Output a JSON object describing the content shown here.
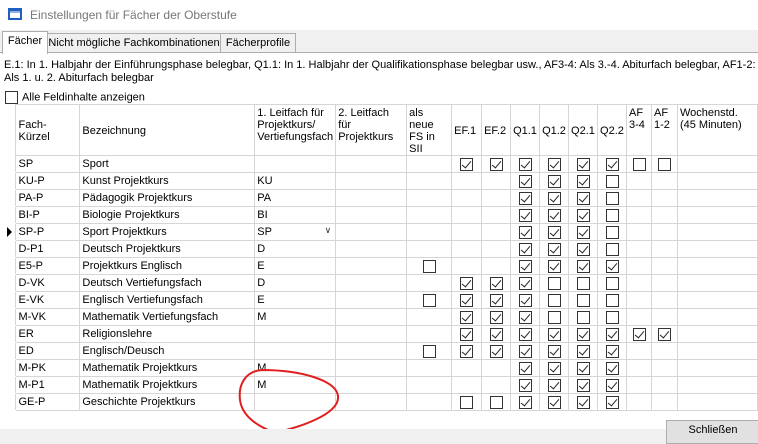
{
  "window": {
    "title": "Einstellungen für Fächer der Oberstufe"
  },
  "tabs": [
    {
      "label": "Fächer",
      "active": true
    },
    {
      "label": "Nicht mögliche Fachkombinationen",
      "active": false
    },
    {
      "label": "Fächerprofile",
      "active": false
    }
  ],
  "hint": {
    "line1": "E.1: In 1. Halbjahr der Einführungsphase belegbar, Q1.1: In 1. Halbjahr der Qualifikationsphase belegbar usw., AF3-4: Als 3.-4. Abiturfach belegbar, AF1-2:",
    "line2": "Als 1. u. 2. Abiturfach belegbar"
  },
  "show_all": {
    "label": "Alle Feldinhalte anzeigen",
    "checked": false
  },
  "columns": [
    "Fach-Kürzel",
    "Bezeichnung",
    "1. Leitfach für Projektkurs/ Vertiefungsfach",
    "2. Leitfach für Projektkurs",
    "als neue FS in SII",
    "EF.1",
    "EF.2",
    "Q1.1",
    "Q1.2",
    "Q2.1",
    "Q2.2",
    "AF 3-4",
    "AF 1-2",
    "Wochenstd. (45 Minuten)"
  ],
  "rows": [
    {
      "kuerzel": "SP",
      "bezeichnung": "Sport",
      "leit1": "",
      "leit2": "",
      "fs": null,
      "checks": [
        true,
        true,
        true,
        true,
        true,
        true,
        false,
        false
      ]
    },
    {
      "kuerzel": "KU-P",
      "bezeichnung": "Kunst Projektkurs",
      "leit1": "KU",
      "leit2": "",
      "fs": null,
      "checks": [
        null,
        null,
        true,
        true,
        true,
        false,
        null,
        null
      ]
    },
    {
      "kuerzel": "PA-P",
      "bezeichnung": "Pädagogik Projektkurs",
      "leit1": "PA",
      "leit2": "",
      "fs": null,
      "checks": [
        null,
        null,
        true,
        true,
        true,
        false,
        null,
        null
      ]
    },
    {
      "kuerzel": "BI-P",
      "bezeichnung": "Biologie Projektkurs",
      "leit1": "BI",
      "leit2": "",
      "fs": null,
      "checks": [
        null,
        null,
        true,
        true,
        true,
        false,
        null,
        null
      ]
    },
    {
      "kuerzel": "SP-P",
      "bezeichnung": "Sport Projektkurs",
      "leit1": "SP",
      "leit2": "",
      "fs": null,
      "checks": [
        null,
        null,
        true,
        true,
        true,
        false,
        null,
        null
      ],
      "selected": true
    },
    {
      "kuerzel": "D-P1",
      "bezeichnung": "Deutsch Projektkurs",
      "leit1": "D",
      "leit2": "",
      "fs": null,
      "checks": [
        null,
        null,
        true,
        true,
        true,
        false,
        null,
        null
      ]
    },
    {
      "kuerzel": "E5-P",
      "bezeichnung": "Projektkurs Englisch",
      "leit1": "E",
      "leit2": "",
      "fs": false,
      "checks": [
        null,
        null,
        true,
        true,
        true,
        true,
        null,
        null
      ]
    },
    {
      "kuerzel": "D-VK",
      "bezeichnung": "Deutsch Vertiefungsfach",
      "leit1": "D",
      "leit2": "",
      "fs": null,
      "checks": [
        true,
        true,
        true,
        false,
        false,
        false,
        null,
        null
      ]
    },
    {
      "kuerzel": "E-VK",
      "bezeichnung": "Englisch Vertiefungsfach",
      "leit1": "E",
      "leit2": "",
      "fs": false,
      "checks": [
        true,
        true,
        true,
        false,
        false,
        false,
        null,
        null
      ]
    },
    {
      "kuerzel": "M-VK",
      "bezeichnung": "Mathematik Vertiefungsfach",
      "leit1": "M",
      "leit2": "",
      "fs": null,
      "checks": [
        true,
        true,
        true,
        false,
        false,
        false,
        null,
        null
      ]
    },
    {
      "kuerzel": "ER",
      "bezeichnung": "Religionslehre",
      "leit1": "",
      "leit2": "",
      "fs": null,
      "checks": [
        true,
        true,
        true,
        true,
        true,
        true,
        true,
        true
      ]
    },
    {
      "kuerzel": "ED",
      "bezeichnung": "Englisch/Deusch",
      "leit1": "",
      "leit2": "",
      "fs": false,
      "checks": [
        true,
        true,
        true,
        true,
        true,
        true,
        null,
        null
      ]
    },
    {
      "kuerzel": "M-PK",
      "bezeichnung": "Mathematik Projektkurs",
      "leit1": "M",
      "leit2": "",
      "fs": null,
      "checks": [
        null,
        null,
        true,
        true,
        true,
        true,
        null,
        null
      ]
    },
    {
      "kuerzel": "M-P1",
      "bezeichnung": "Mathematik Projektkurs",
      "leit1": "M",
      "leit2": "",
      "fs": null,
      "checks": [
        null,
        null,
        true,
        true,
        true,
        true,
        null,
        null
      ]
    },
    {
      "kuerzel": "GE-P",
      "bezeichnung": "Geschichte Projektkurs",
      "leit1": "",
      "leit2": "",
      "fs": null,
      "checks": [
        false,
        false,
        true,
        true,
        true,
        true,
        null,
        null
      ]
    }
  ],
  "ok_button": {
    "label": "Schließen"
  },
  "colors": {
    "accent": "#1f5fbf",
    "annotation_red": "#e02020",
    "grid": "#d6d6d6"
  }
}
